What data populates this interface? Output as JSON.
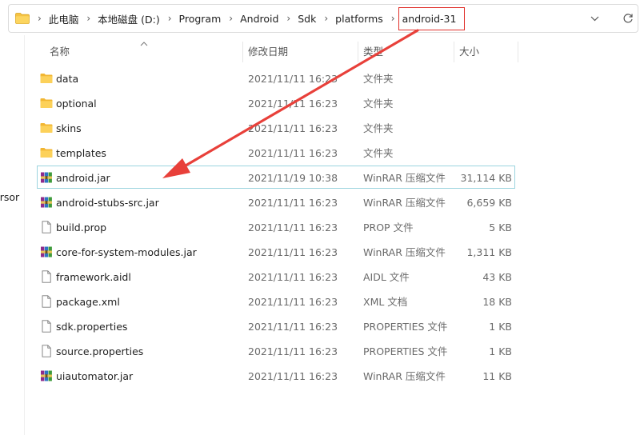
{
  "breadcrumb": [
    "此电脑",
    "本地磁盘 (D:)",
    "Program",
    "Android",
    "Sdk",
    "platforms",
    "android-31"
  ],
  "left_clip_text": "ersor",
  "columns": {
    "name": "名称",
    "date": "修改日期",
    "type": "类型",
    "size": "大小"
  },
  "files": [
    {
      "name": "data",
      "date": "2021/11/11 16:23",
      "type": "文件夹",
      "size": "",
      "icon": "folder-icon"
    },
    {
      "name": "optional",
      "date": "2021/11/11 16:23",
      "type": "文件夹",
      "size": "",
      "icon": "folder-icon"
    },
    {
      "name": "skins",
      "date": "2021/11/11 16:23",
      "type": "文件夹",
      "size": "",
      "icon": "folder-icon"
    },
    {
      "name": "templates",
      "date": "2021/11/11 16:23",
      "type": "文件夹",
      "size": "",
      "icon": "folder-icon"
    },
    {
      "name": "android.jar",
      "date": "2021/11/19 10:38",
      "type": "WinRAR 压缩文件",
      "size": "31,114 KB",
      "icon": "winrar-icon",
      "selected": true
    },
    {
      "name": "android-stubs-src.jar",
      "date": "2021/11/11 16:23",
      "type": "WinRAR 压缩文件",
      "size": "6,659 KB",
      "icon": "winrar-icon"
    },
    {
      "name": "build.prop",
      "date": "2021/11/11 16:23",
      "type": "PROP 文件",
      "size": "5 KB",
      "icon": "file-icon"
    },
    {
      "name": "core-for-system-modules.jar",
      "date": "2021/11/11 16:23",
      "type": "WinRAR 压缩文件",
      "size": "1,311 KB",
      "icon": "winrar-icon"
    },
    {
      "name": "framework.aidl",
      "date": "2021/11/11 16:23",
      "type": "AIDL 文件",
      "size": "43 KB",
      "icon": "file-icon"
    },
    {
      "name": "package.xml",
      "date": "2021/11/11 16:23",
      "type": "XML 文档",
      "size": "18 KB",
      "icon": "file-icon"
    },
    {
      "name": "sdk.properties",
      "date": "2021/11/11 16:23",
      "type": "PROPERTIES 文件",
      "size": "1 KB",
      "icon": "file-icon"
    },
    {
      "name": "source.properties",
      "date": "2021/11/11 16:23",
      "type": "PROPERTIES 文件",
      "size": "1 KB",
      "icon": "file-icon"
    },
    {
      "name": "uiautomator.jar",
      "date": "2021/11/11 16:23",
      "type": "WinRAR 压缩文件",
      "size": "11 KB",
      "icon": "winrar-icon"
    }
  ],
  "icons": {
    "address_bar": "folder-icon",
    "separator": "chevron-right-icon",
    "dropdown": "chevron-down-icon",
    "refresh": "refresh-icon",
    "sort": "sort-up-icon"
  },
  "colors": {
    "highlight": "#e0302a",
    "selection_border": "#9cd4df",
    "folder": "#f6c343",
    "annotation_arrow": "#e8403a"
  }
}
